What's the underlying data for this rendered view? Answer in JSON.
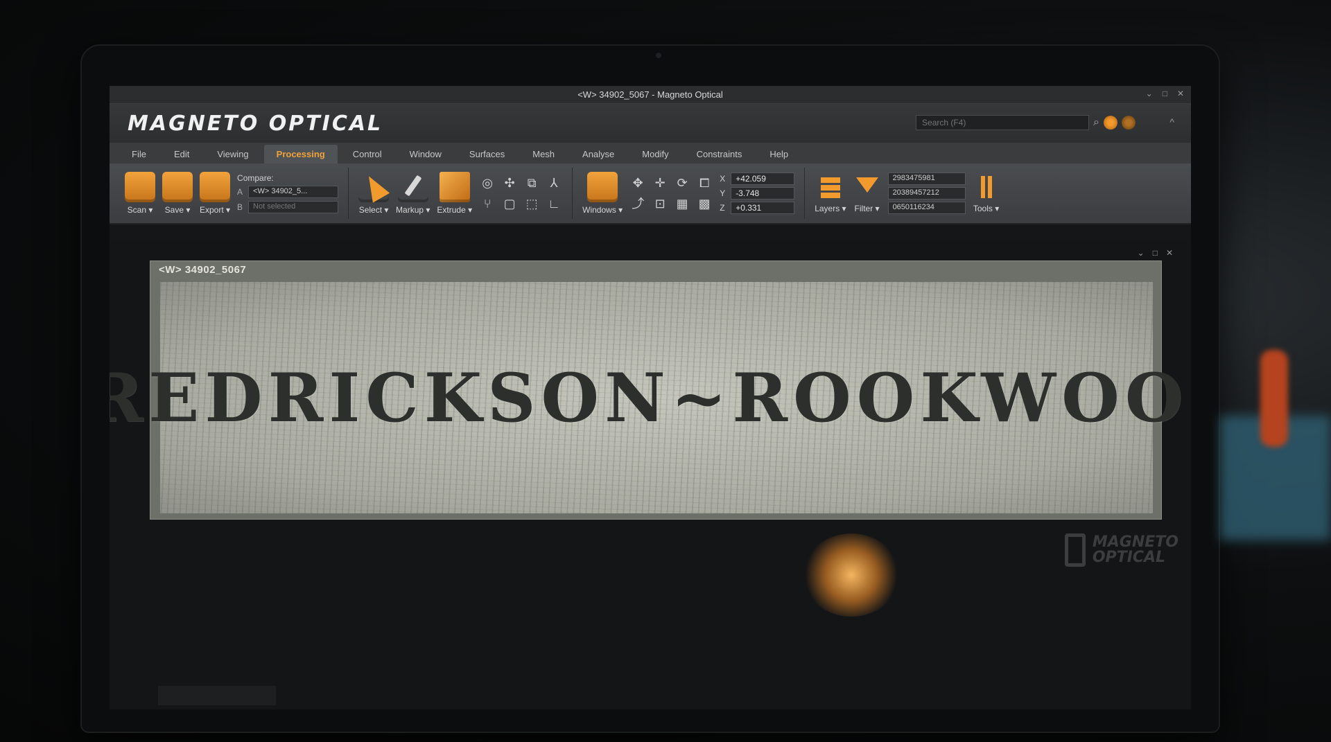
{
  "window": {
    "title": "<W> 34902_5067 - Magneto Optical",
    "controls": [
      "⌄",
      "□",
      "✕"
    ]
  },
  "header": {
    "logo_text": "MAGNETO OPTICAL",
    "search_placeholder": "Search (F4)",
    "collapse_glyph": "^"
  },
  "tabs": [
    {
      "label": "File"
    },
    {
      "label": "Edit"
    },
    {
      "label": "Viewing"
    },
    {
      "label": "Processing",
      "active": true
    },
    {
      "label": "Control"
    },
    {
      "label": "Window"
    },
    {
      "label": "Surfaces"
    },
    {
      "label": "Mesh"
    },
    {
      "label": "Analyse"
    },
    {
      "label": "Modify"
    },
    {
      "label": "Constraints"
    },
    {
      "label": "Help"
    }
  ],
  "ribbon": {
    "scan_label": "Scan ▾",
    "save_label": "Save ▾",
    "export_label": "Export ▾",
    "compare": {
      "title": "Compare:",
      "a_key": "A",
      "a_value": "<W> 34902_5...",
      "b_key": "B",
      "b_placeholder": "Not selected"
    },
    "select_label": "Select ▾",
    "markup_label": "Markup ▾",
    "extrude_label": "Extrude ▾",
    "tool_icons_top": [
      "◎",
      "✣",
      "⧉",
      "⅄"
    ],
    "tool_icons_bottom": [
      "⑂",
      "▢",
      "⬚",
      "∟"
    ],
    "windows_label": "Windows ▾",
    "nav_icons_top": [
      "✥",
      "✛",
      "⟳",
      "⧠"
    ],
    "nav_icons_bottom": [
      "⤴",
      "⊡",
      "▦",
      "▩"
    ],
    "coords": {
      "x_label": "X",
      "x_value": "+42.059",
      "y_label": "Y",
      "y_value": "-3.748",
      "z_label": "Z",
      "z_value": "+0.331"
    },
    "layers_label": "Layers ▾",
    "filter_label": "Filter ▾",
    "ids": [
      "2983475981",
      "20389457212",
      "0650116234"
    ],
    "tools_label": "Tools ▾"
  },
  "document": {
    "tab_title": "<W> 34902_5067",
    "controls": [
      "⌄",
      "□",
      "✕"
    ],
    "stencil_text": "FREDRICKSON~ROOKWOOD."
  },
  "watermark": {
    "line1": "MAGNETO",
    "line2": "OPTICAL"
  },
  "colors": {
    "accent": "#f29a2c",
    "panel": "#3b3d40",
    "scan_paper": "#b4b6ac",
    "stencil_ink": "#2c2f2c"
  }
}
